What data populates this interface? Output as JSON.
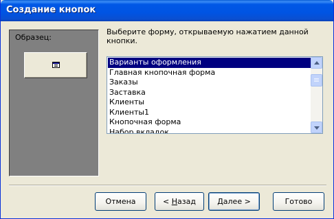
{
  "window": {
    "title": "Создание кнопок"
  },
  "sample": {
    "label": "Образец:",
    "icon": "form-icon"
  },
  "instruction": "Выберите форму, открываемую нажатием данной кнопки.",
  "list": {
    "items": [
      "Варианты оформления",
      "Главная кнопочная форма",
      "Заказы",
      "Заставка",
      "Клиенты",
      "Клиенты1",
      "Кнопочная форма",
      "Набор вкладок"
    ],
    "selected_index": 0
  },
  "buttons": {
    "cancel": "Отмена",
    "back_prefix": "< ",
    "back_key": "Н",
    "back_rest": "азад",
    "next_key": "Д",
    "next_rest": "алее >",
    "finish": "Готово"
  },
  "colors": {
    "selection": "#000080",
    "titlebar": "#0054e3",
    "sample_panel": "#808080"
  }
}
